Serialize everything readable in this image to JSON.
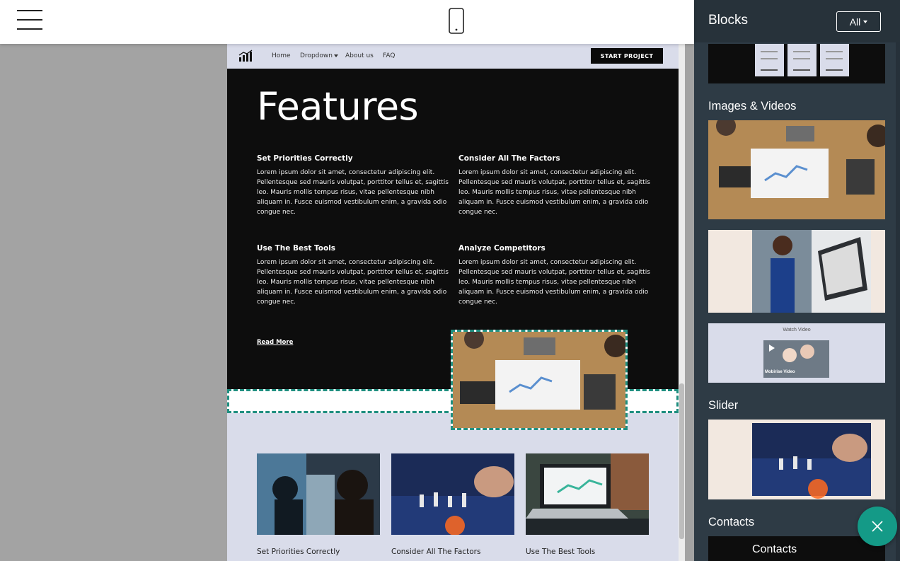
{
  "toolbar": {
    "menu_icon": "hamburger-icon",
    "device_icon": "mobile-phone-icon"
  },
  "site": {
    "nav": {
      "logo_icon": "chart-logo-icon",
      "links": [
        "Home",
        "Dropdown",
        "About us",
        "FAQ"
      ],
      "cta": "START PROJECT"
    },
    "features": {
      "title": "Features",
      "items": [
        {
          "title": "Set Priorities Correctly",
          "text": "Lorem ipsum dolor sit amet, consectetur adipiscing elit. Pellentesque sed mauris volutpat, porttitor tellus et, sagittis leo. Mauris mollis tempus risus, vitae pellentesque nibh aliquam in. Fusce euismod vestibulum enim, a gravida odio congue nec."
        },
        {
          "title": "Consider All The Factors",
          "text": "Lorem ipsum dolor sit amet, consectetur adipiscing elit. Pellentesque sed mauris volutpat, porttitor tellus et, sagittis leo. Mauris mollis tempus risus, vitae pellentesque nibh aliquam in. Fusce euismod vestibulum enim, a gravida odio congue nec."
        },
        {
          "title": "Use The Best Tools",
          "text": "Lorem ipsum dolor sit amet, consectetur adipiscing elit. Pellentesque sed mauris volutpat, porttitor tellus et, sagittis leo. Mauris mollis tempus risus, vitae pellentesque nibh aliquam in. Fusce euismod vestibulum enim, a gravida odio congue nec."
        },
        {
          "title": "Analyze Competitors",
          "text": "Lorem ipsum dolor sit amet, consectetur adipiscing elit. Pellentesque sed mauris volutpat, porttitor tellus et, sagittis leo. Mauris mollis tempus risus, vitae pellentesque nibh aliquam in. Fusce euismod vestibulum enim, a gravida odio congue nec."
        }
      ],
      "read_more": "Read More"
    },
    "cards": [
      {
        "label": "Set Priorities Correctly"
      },
      {
        "label": "Consider All The Factors"
      },
      {
        "label": "Use The Best Tools"
      }
    ]
  },
  "panel": {
    "title": "Blocks",
    "filter": "All",
    "sections": {
      "images_videos": "Images & Videos",
      "slider": "Slider",
      "contacts": "Contacts"
    },
    "video_thumb_title": "Watch Video",
    "video_thumb_caption": "Mobirise Video",
    "contacts_thumb_label": "Contacts"
  },
  "fab": {
    "icon": "close-icon"
  },
  "colors": {
    "accent": "#149a87",
    "panel_bg": "#2e3b45",
    "dashed_outline": "#1f8f80"
  }
}
